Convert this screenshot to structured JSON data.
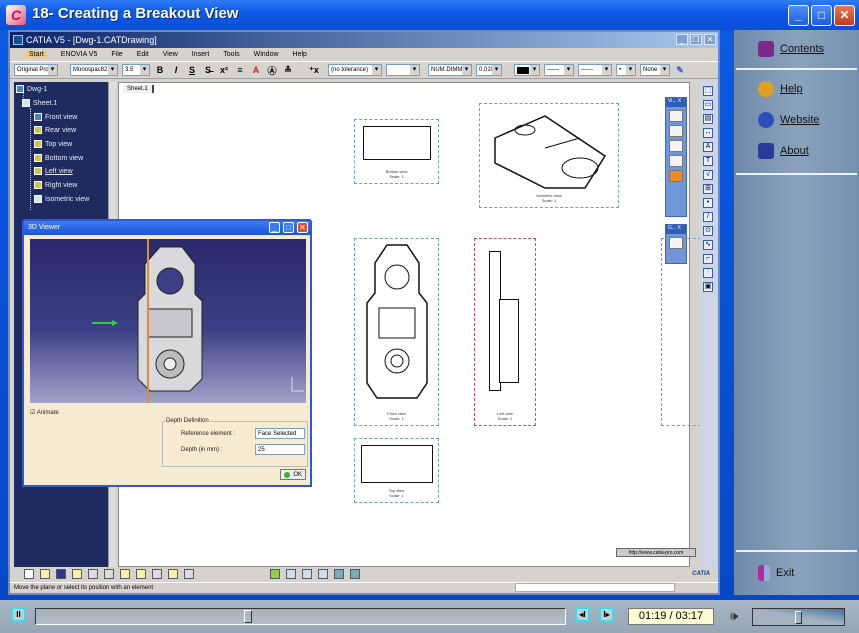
{
  "player": {
    "title": "18- Creating a Breakout View",
    "window_buttons": {
      "minimize": "_",
      "maximize": "□",
      "close": "✕"
    },
    "time_display": "01:19 / 03:17",
    "seek_progress": 0.4,
    "volume_level": 0.5,
    "controls": {
      "pause": "II",
      "prev": "◂I",
      "next": "I▸"
    }
  },
  "side_panel": {
    "items": [
      {
        "label": "Contents",
        "icon": "book-icon",
        "color": "#7a2a8a"
      },
      {
        "label": "Help",
        "icon": "help-icon",
        "color": "#e0a020"
      },
      {
        "label": "Website",
        "icon": "globe-icon",
        "color": "#2a4fb8"
      },
      {
        "label": "About",
        "icon": "about-window-icon",
        "color": "#2a3a9a"
      }
    ],
    "exit_label": "Exit"
  },
  "catia": {
    "title": "CATIA V5 - [Dwg-1.CATDrawing]",
    "menu": [
      "Start",
      "ENOVIA V5",
      "File",
      "Edit",
      "View",
      "Insert",
      "Tools",
      "Window",
      "Help"
    ],
    "toolbar": {
      "style": "Original Pro",
      "font": "Monospac821",
      "font_size": "3.5",
      "format_buttons": [
        "B",
        "I",
        "S",
        "S̶",
        "x²"
      ],
      "tolerance": "(no tolerance)",
      "numeric_format": "NUM.DIMM",
      "precision": "0.010",
      "line_none": "None"
    },
    "tree": {
      "root": "Dwg-1",
      "sheet": "Sheet.1",
      "views": [
        "Front view",
        "Rear view",
        "Top view",
        "Bottom view",
        "Left view",
        "Right view",
        "Isometric view"
      ]
    },
    "sheet_tab": "Sheet.1",
    "views": [
      {
        "caption": "Bottom view",
        "scale": "Scale: 1"
      },
      {
        "caption": "Isometric view",
        "scale": "Scale: 1"
      },
      {
        "caption": "Front view",
        "scale": "Scale: 1"
      },
      {
        "caption": "Left view",
        "scale": "Scale: 1"
      },
      {
        "caption": "Top view",
        "scale": "Scale: 1"
      }
    ],
    "url_label": "http://www.catia-pro.com",
    "floating_toolbars": [
      {
        "title": "Vi... X"
      },
      {
        "title": "G... X"
      }
    ],
    "status_text": "Move the plane or select its position with an element",
    "brand": "CATIA"
  },
  "viewer": {
    "title": "3D Viewer",
    "animate_label": "Animate",
    "depth_group": "Depth Definition",
    "reference_label": "Reference element :",
    "reference_value": "Face Selected",
    "depth_label": "Depth (in mm) :",
    "depth_value": "25",
    "ok_label": "OK"
  }
}
